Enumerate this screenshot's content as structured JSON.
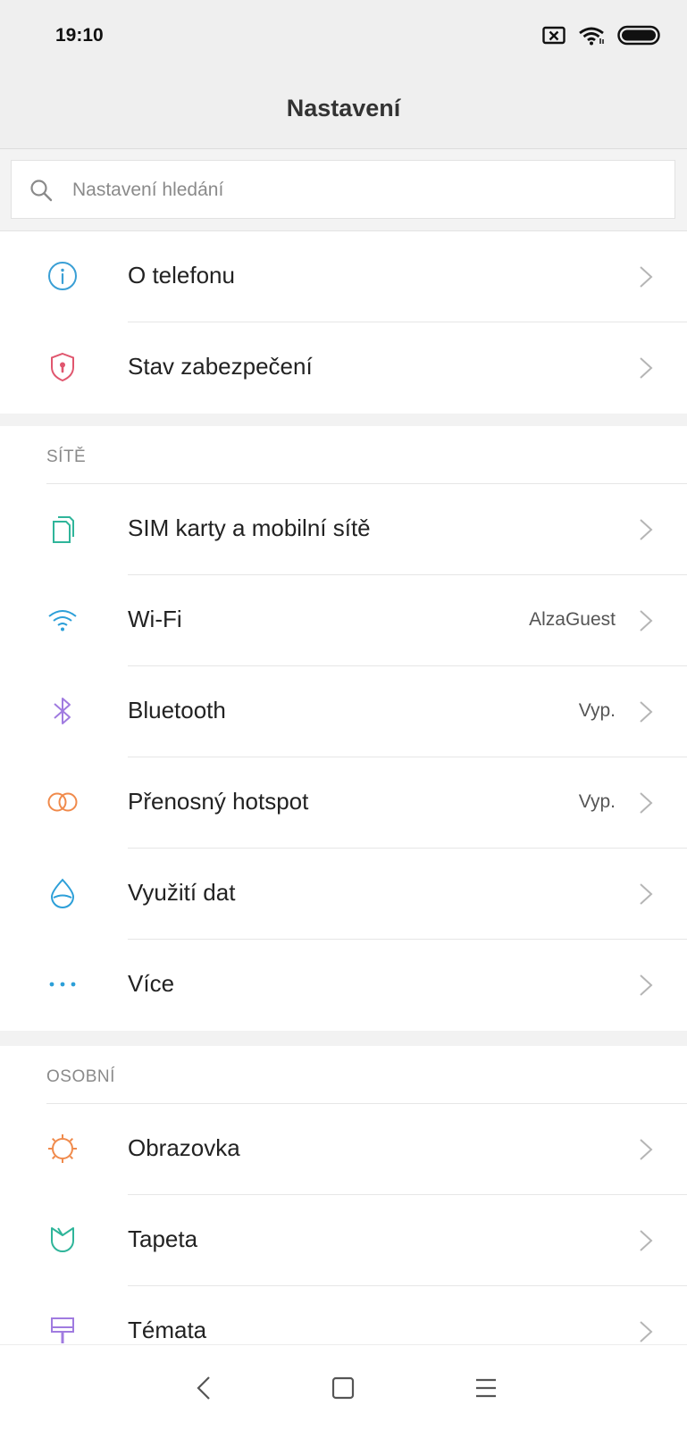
{
  "status_bar": {
    "time": "19:10",
    "icons": [
      "no-sim-icon",
      "wifi-icon",
      "battery-icon"
    ]
  },
  "header": {
    "title": "Nastavení"
  },
  "search": {
    "placeholder": "Nastavení hledání",
    "value": ""
  },
  "top_items": [
    {
      "label": "O telefonu",
      "icon": "info-icon",
      "color": "#3a9fd5"
    },
    {
      "label": "Stav zabezpečení",
      "icon": "shield-icon",
      "color": "#e0566e"
    }
  ],
  "sections": [
    {
      "title": "SÍTĚ",
      "items": [
        {
          "label": "SIM karty a mobilní sítě",
          "icon": "sim-card-icon",
          "color": "#2fb59a",
          "value": ""
        },
        {
          "label": "Wi-Fi",
          "icon": "wifi-icon",
          "color": "#2c9fd8",
          "value": "AlzaGuest"
        },
        {
          "label": "Bluetooth",
          "icon": "bluetooth-icon",
          "color": "#a07be0",
          "value": "Vyp."
        },
        {
          "label": "Přenosný hotspot",
          "icon": "hotspot-icon",
          "color": "#f08a4b",
          "value": "Vyp."
        },
        {
          "label": "Využití dat",
          "icon": "data-drop-icon",
          "color": "#2c9fd8",
          "value": ""
        },
        {
          "label": "Více",
          "icon": "more-dots-icon",
          "color": "#2c9fd8",
          "value": ""
        }
      ]
    },
    {
      "title": "OSOBNÍ",
      "items": [
        {
          "label": "Obrazovka",
          "icon": "sun-icon",
          "color": "#f08a4b",
          "value": ""
        },
        {
          "label": "Tapeta",
          "icon": "tulip-icon",
          "color": "#2fb59a",
          "value": ""
        },
        {
          "label": "Témata",
          "icon": "brush-icon",
          "color": "#a07be0",
          "value": ""
        }
      ]
    }
  ],
  "nav_bar": {
    "buttons": [
      "back-icon",
      "home-icon",
      "menu-icon"
    ]
  }
}
